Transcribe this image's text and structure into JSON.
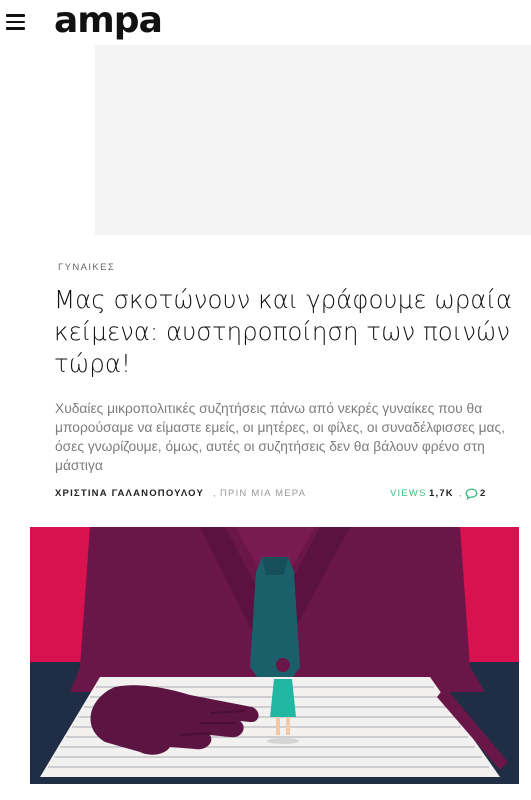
{
  "brand": {
    "logo": "ampa"
  },
  "article": {
    "category": "ΓΥΝΑΙΚΕΣ",
    "title": "Μας σκοτώνουν και γράφουμε ωραία κείμενα: αυστηροποίηση των ποινών τώρα!",
    "excerpt": "Χυδαίες μικροπολιτικές συζητήσεις πάνω από νεκρές γυναίκες που θα μπορούσαμε να είμαστε εμείς, οι μητέρες, οι φίλες, οι συναδέλφισσες μας, όσες γνωρίζουμε, όμως, αυτές οι συζητήσεις δεν θα βάλουν φρένο στη μάστιγα",
    "author": "ΧΡΙΣΤΙΝΑ ΓΑΛΑΝΟΠΟΥΛΟΥ",
    "separator": ",",
    "published": "ΠΡΙΝ ΜΙΑ ΜΕΡΑ",
    "views_label": "VIEWS",
    "views": "1,7K",
    "comments_separator": ",",
    "comments": "2"
  },
  "icons": {
    "menu": "hamburger-menu-icon",
    "comment": "speech-bubble-icon"
  },
  "colors": {
    "accent_views": "#3fbf7f",
    "comment_icon": "#3fbf7f",
    "hero_red": "#d8124f",
    "hero_purple": "#6a1648",
    "hero_navy": "#1f2d45",
    "hero_tie": "#1b5f6a",
    "hero_dress": "#22b7a3"
  }
}
